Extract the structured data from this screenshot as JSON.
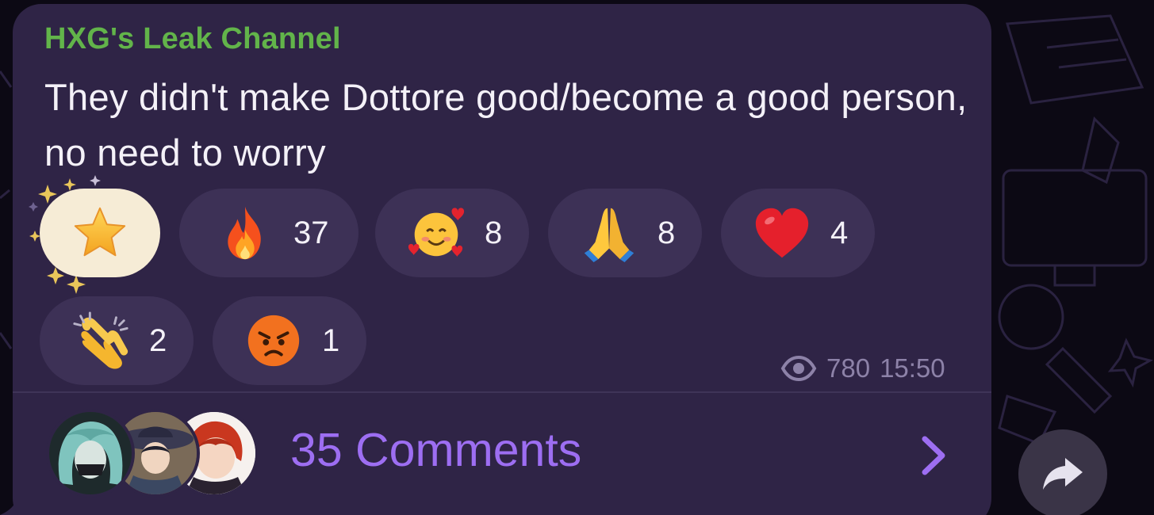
{
  "message": {
    "channel_name": "HXG's Leak Channel",
    "text": "They didn't make Dottore good/become a good person, no need to worry",
    "views": "780",
    "time": "15:50"
  },
  "reactions": [
    {
      "icon": "star-emoji",
      "count": "",
      "selected": true
    },
    {
      "icon": "fire-emoji",
      "count": "37"
    },
    {
      "icon": "smiling-face-with-hearts-emoji",
      "count": "8"
    },
    {
      "icon": "folded-hands-emoji",
      "count": "8"
    },
    {
      "icon": "red-heart-emoji",
      "count": "4"
    },
    {
      "icon": "clapping-hands-emoji",
      "count": "2"
    },
    {
      "icon": "angry-face-emoji",
      "count": "1"
    }
  ],
  "comments": {
    "label": "35 Comments",
    "avatars": [
      "avatar-teal-hair",
      "avatar-wide-hat",
      "avatar-red-hair"
    ]
  },
  "colors": {
    "bubble": "#2f2446",
    "channel_name": "#62b44a",
    "accent": "#9d6ef2",
    "meta": "#8d82a8"
  }
}
